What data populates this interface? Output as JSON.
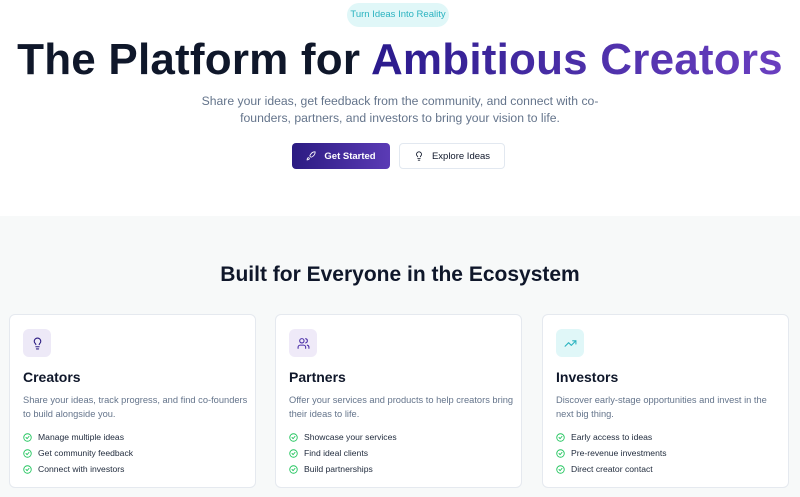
{
  "hero": {
    "badge": "Turn Ideas Into Reality",
    "title_plain": "The Platform for ",
    "title_highlight": "Ambitious Creators",
    "subtitle": "Share your ideas, get feedback from the community, and connect with co-founders, partners, and investors to bring your vision to life.",
    "primary_button": "Get Started",
    "primary_icon": "rocket-icon",
    "secondary_button": "Explore Ideas",
    "secondary_icon": "lightbulb-icon"
  },
  "section": {
    "title": "Built for Everyone in the Ecosystem",
    "cards": [
      {
        "icon": "lightbulb-icon",
        "title": "Creators",
        "description": "Share your ideas, track progress, and find co-founders to build alongside you.",
        "features": [
          "Manage multiple ideas",
          "Get community feedback",
          "Connect with investors"
        ]
      },
      {
        "icon": "users-icon",
        "title": "Partners",
        "description": "Offer your services and products to help creators bring their ideas to life.",
        "features": [
          "Showcase your services",
          "Find ideal clients",
          "Build partnerships"
        ]
      },
      {
        "icon": "trending-up-icon",
        "title": "Investors",
        "description": "Discover early-stage opportunities and invest in the next big thing.",
        "features": [
          "Early access to ideas",
          "Pre-revenue investments",
          "Direct creator contact"
        ]
      }
    ]
  },
  "colors": {
    "primary_gradient_start": "#2b1b82",
    "primary_gradient_end": "#5b3bb5",
    "badge_bg": "#e0f7f8",
    "badge_text": "#2bb3c0",
    "check_green": "#22c55e",
    "creators_icon_bg": "#ede9f7",
    "partners_icon_bg": "#efeaf8",
    "investors_icon_bg": "#e0f7f8"
  }
}
